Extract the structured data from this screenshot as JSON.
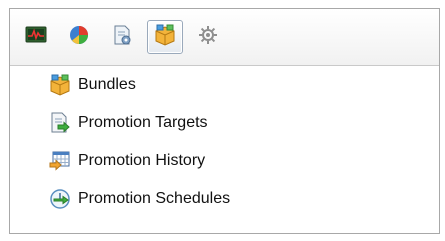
{
  "toolbar": {
    "buttons": [
      {
        "icon": "monitor-chart-icon",
        "active": false
      },
      {
        "icon": "pie-chart-icon",
        "active": false
      },
      {
        "icon": "document-gear-icon",
        "active": false
      },
      {
        "icon": "bundle-box-icon",
        "active": true
      },
      {
        "icon": "gear-icon",
        "active": false
      }
    ]
  },
  "menu": {
    "items": [
      {
        "label": "Bundles",
        "icon": "bundle-box-icon"
      },
      {
        "label": "Promotion Targets",
        "icon": "document-arrow-icon"
      },
      {
        "label": "Promotion History",
        "icon": "calendar-arrow-icon"
      },
      {
        "label": "Promotion Schedules",
        "icon": "clock-arrow-icon"
      }
    ]
  },
  "colors": {
    "toolbar_bg": "#f1f1f1",
    "border": "#a8a8a8",
    "active_border": "#9aa9bb"
  }
}
